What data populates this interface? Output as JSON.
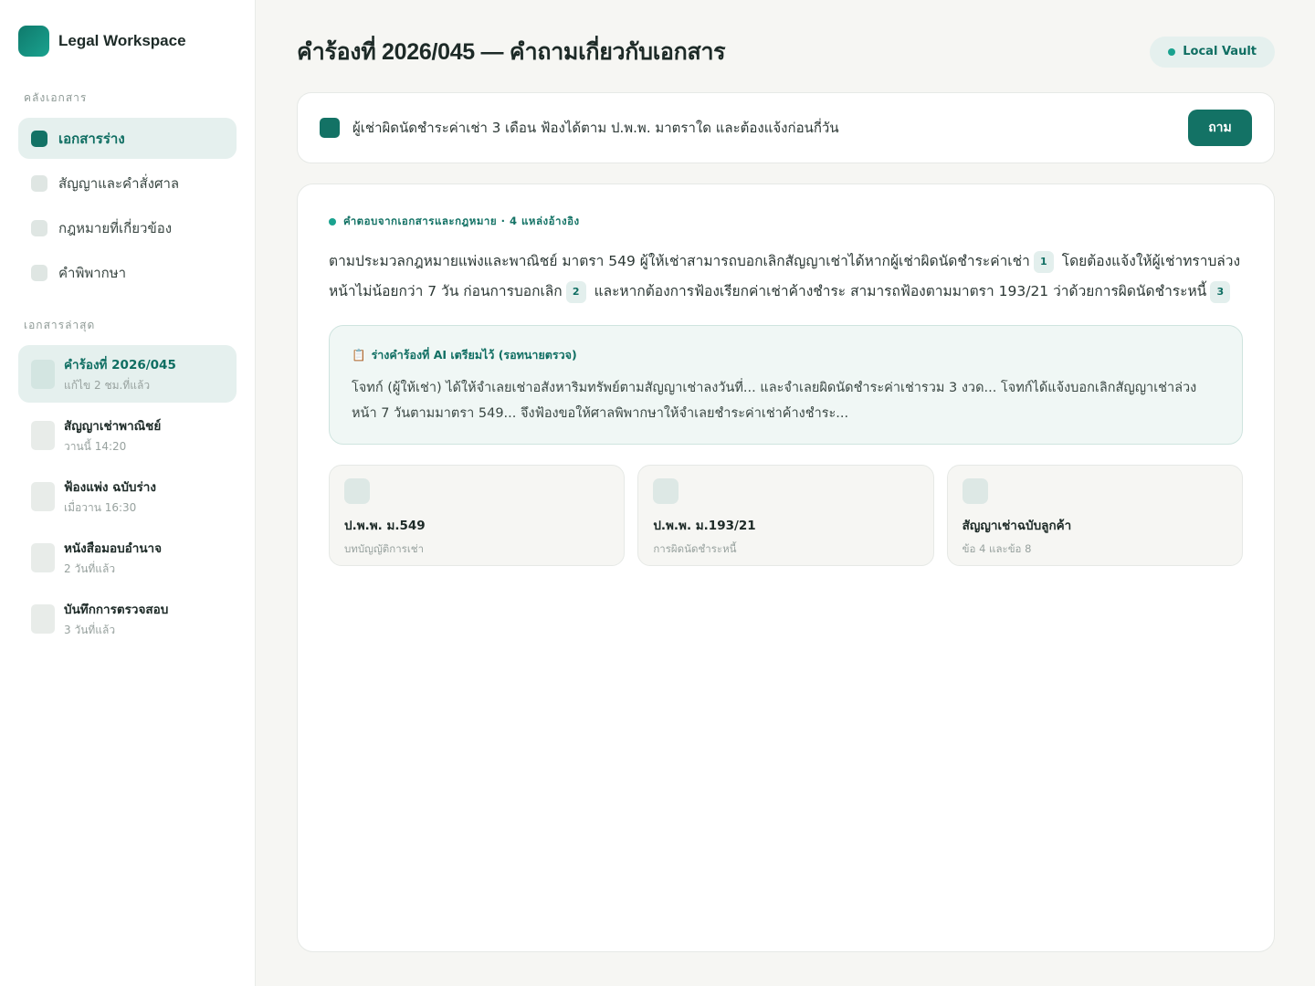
{
  "brand": {
    "name": "Legal Workspace"
  },
  "sidebar": {
    "library_label": "คลังเอกสาร",
    "nav": [
      {
        "label": "เอกสารร่าง",
        "active": true
      },
      {
        "label": "สัญญาและคำสั่งศาล",
        "active": false
      },
      {
        "label": "กฎหมายที่เกี่ยวข้อง",
        "active": false
      },
      {
        "label": "คำพิพากษา",
        "active": false
      }
    ],
    "recent_label": "เอกสารล่าสุด",
    "recent": [
      {
        "title": "คำร้องที่ 2026/045",
        "sub": "แก้ไข 2 ชม.ที่แล้ว",
        "active": true
      },
      {
        "title": "สัญญาเช่าพาณิชย์",
        "sub": "วานนี้ 14:20",
        "active": false
      },
      {
        "title": "ฟ้องแพ่ง ฉบับร่าง",
        "sub": "เมื่อวาน 16:30",
        "active": false
      },
      {
        "title": "หนังสือมอบอำนาจ",
        "sub": "2 วันที่แล้ว",
        "active": false
      },
      {
        "title": "บันทึกการตรวจสอบ",
        "sub": "3 วันที่แล้ว",
        "active": false
      }
    ]
  },
  "header": {
    "title": "คำร้องที่ 2026/045 — คำถามเกี่ยวกับเอกสาร",
    "vault_badge": "Local Vault"
  },
  "query": {
    "text": "ผู้เช่าผิดนัดชำระค่าเช่า 3 เดือน ฟ้องได้ตาม ป.พ.พ. มาตราใด และต้องแจ้งก่อนกี่วัน",
    "ask_label": "ถาม"
  },
  "answer": {
    "meta": "คำตอบจากเอกสารและกฎหมาย · 4 แหล่งอ้างอิง",
    "part1": "ตามประมวลกฎหมายแพ่งและพาณิชย์ มาตรา 549 ผู้ให้เช่าสามารถบอกเลิกสัญญาเช่าได้หากผู้เช่าผิดนัดชำระค่าเช่า",
    "cite1": "1",
    "part2": "โดยต้องแจ้งให้ผู้เช่าทราบล่วงหน้าไม่น้อยกว่า 7 วัน ก่อนการบอกเลิก",
    "cite2": "2",
    "part3": "และหากต้องการฟ้องเรียกค่าเช่าค้างชำระ สามารถฟ้องตามมาตรา 193/21 ว่าด้วยการผิดนัดชำระหนี้",
    "cite3": "3"
  },
  "draft": {
    "icon": "clipboard-icon",
    "icon_glyph": "📋",
    "title": "ร่างคำร้องที่ AI เตรียมไว้ (รอทนายตรวจ)",
    "text": "โจทก์ (ผู้ให้เช่า) ได้ให้จำเลยเช่าอสังหาริมทรัพย์ตามสัญญาเช่าลงวันที่... และจำเลยผิดนัดชำระค่าเช่ารวม 3 งวด... โจทก์ได้แจ้งบอกเลิกสัญญาเช่าล่วงหน้า 7 วันตามมาตรา 549... จึงฟ้องขอให้ศาลพิพากษาให้จำเลยชำระค่าเช่าค้างชำระ..."
  },
  "sources": [
    {
      "title": "ป.พ.พ. ม.549",
      "sub": "บทบัญญัติการเช่า"
    },
    {
      "title": "ป.พ.พ. ม.193/21",
      "sub": "การผิดนัดชำระหนี้"
    },
    {
      "title": "สัญญาเช่าฉบับลูกค้า",
      "sub": "ข้อ 4 และข้อ 8"
    }
  ],
  "colors": {
    "accent": "#137265",
    "accent_light": "#e5f0ee",
    "background": "#f6f6f3"
  }
}
